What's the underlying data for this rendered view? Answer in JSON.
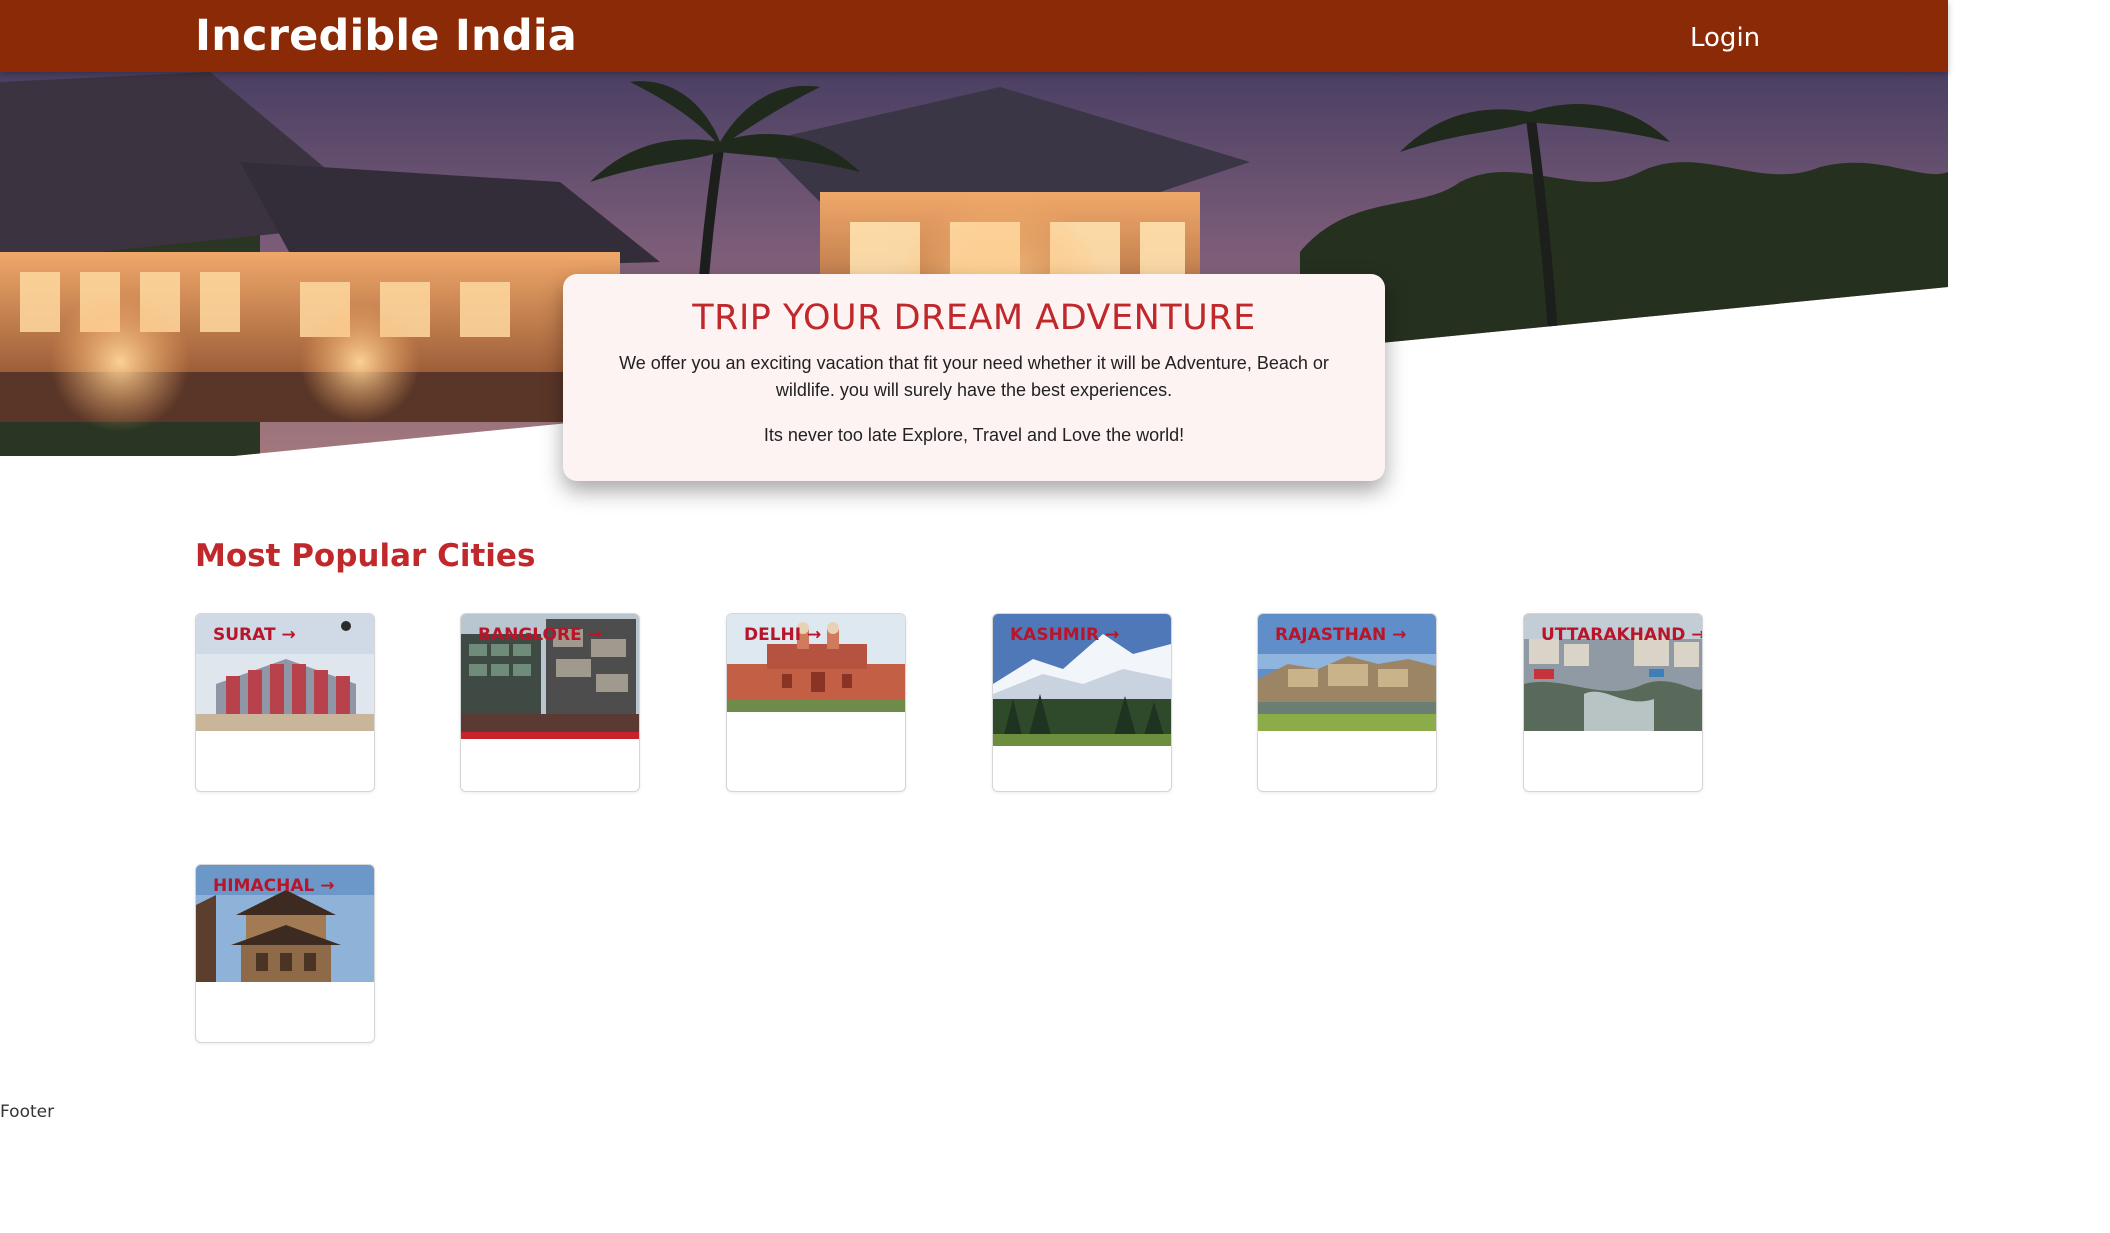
{
  "header": {
    "brand": "Incredible India",
    "login_label": "Login",
    "background_color": "#8b2a06"
  },
  "hero": {
    "title": "TRIP YOUR DREAM ADVENTURE",
    "description": "We offer you an exciting vacation that fit your need whether it will be Adventure, Beach or wildlife. you will surely have the best experiences.",
    "tagline": "Its never too late Explore, Travel and Love the world!",
    "image": "resort-at-dusk-photo"
  },
  "section": {
    "title": "Most Popular Cities",
    "accent_color": "#c0282b"
  },
  "cities": [
    {
      "label": "SURAT →",
      "image": "surat-building-photo"
    },
    {
      "label": "BANGLORE →",
      "image": "bangalore-building-photo"
    },
    {
      "label": "DELHI →",
      "image": "red-fort-photo"
    },
    {
      "label": "KASHMIR →",
      "image": "kashmir-mountains-photo"
    },
    {
      "label": "RAJASTHAN →",
      "image": "rajasthan-fort-photo"
    },
    {
      "label": "UTTARAKHAND →",
      "image": "uttarakhand-town-photo"
    },
    {
      "label": "HIMACHAL →",
      "image": "himachal-temple-photo"
    }
  ],
  "footer": {
    "text": "Footer"
  }
}
